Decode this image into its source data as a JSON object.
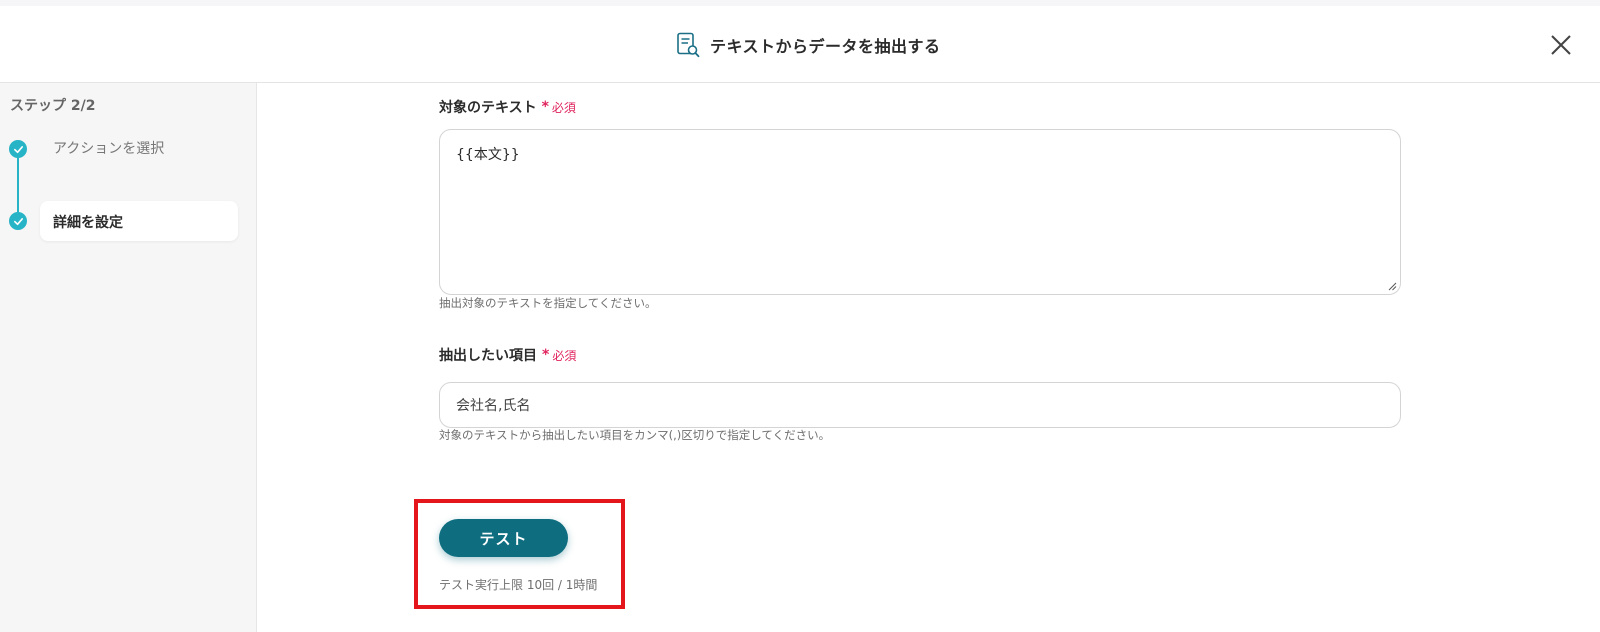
{
  "header": {
    "title": "テキストからデータを抽出する",
    "icon": "document-search-icon",
    "close_icon": "close-icon"
  },
  "sidebar": {
    "step_label": "ステップ 2/2",
    "steps": [
      {
        "label": "アクションを選択",
        "status": "completed"
      },
      {
        "label": "詳細を設定",
        "status": "current"
      }
    ]
  },
  "form": {
    "target_text": {
      "label": "対象のテキスト",
      "required_mark": "*",
      "required_text": "必須",
      "value": "{{本文}}",
      "hint": "抽出対象のテキストを指定してください。"
    },
    "extract_items": {
      "label": "抽出したい項目",
      "required_mark": "*",
      "required_text": "必須",
      "value": "会社名,氏名",
      "hint": "対象のテキストから抽出したい項目をカンマ(,)区切りで指定してください。"
    },
    "test_button_label": "テスト",
    "test_limit": "テスト実行上限 10回 / 1時間"
  },
  "colors": {
    "accent": "#27b4c6",
    "button": "#0e6e80",
    "required": "#e0245e",
    "highlight": "#e4161c"
  }
}
